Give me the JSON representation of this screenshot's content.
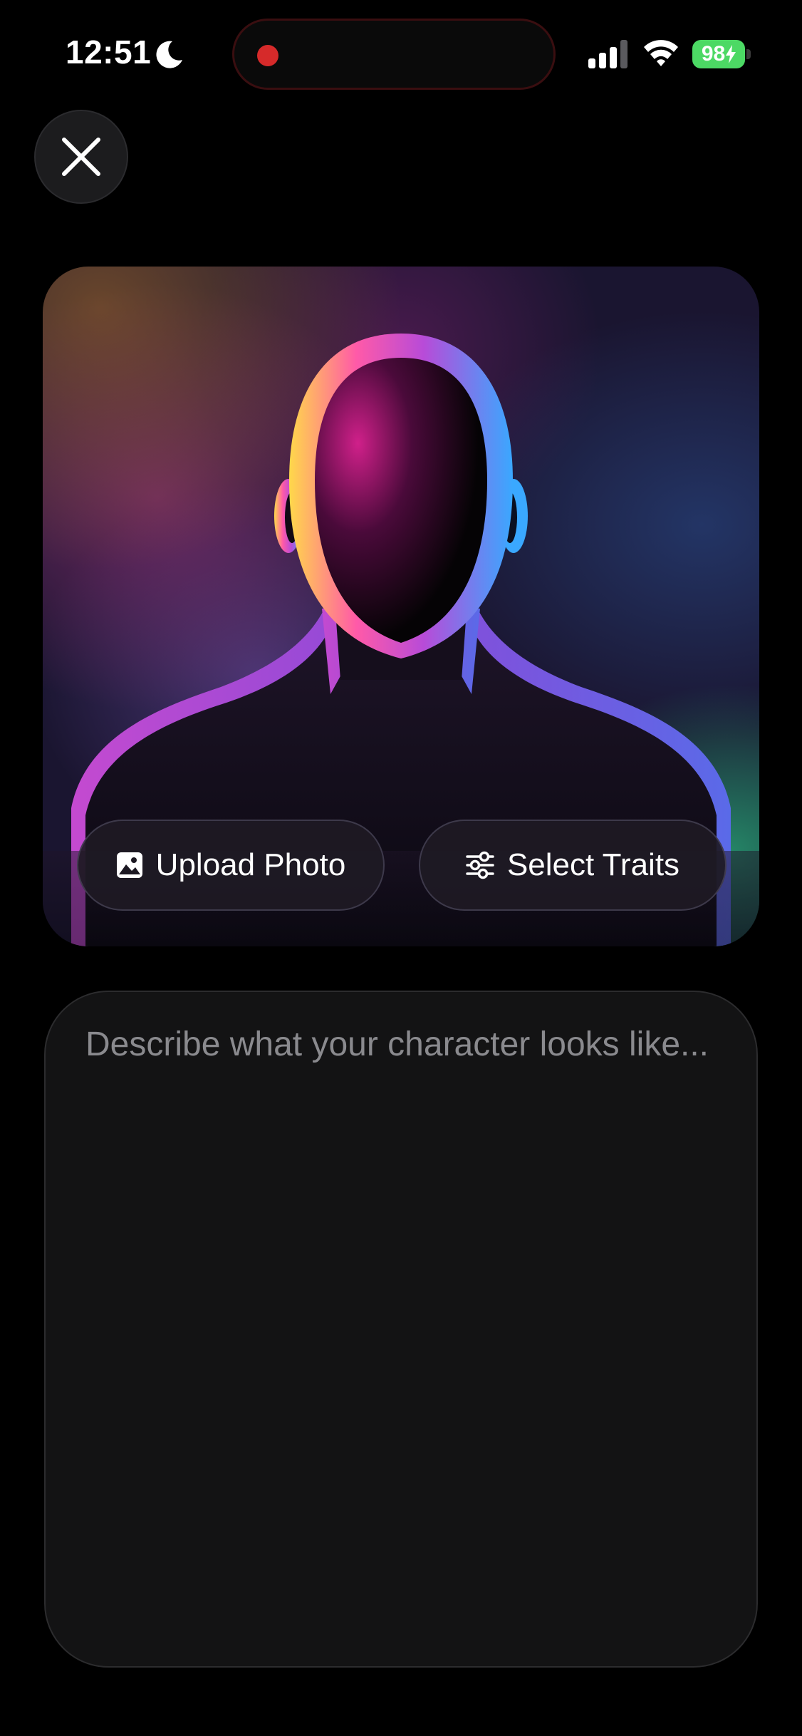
{
  "status_bar": {
    "time": "12:51",
    "battery_level": "98",
    "icons": [
      "moon-icon",
      "signal-icon",
      "wifi-icon",
      "battery-icon"
    ],
    "recording_color": "#d62a2a",
    "battery_color": "#4cd964"
  },
  "close_button": {
    "icon": "close-icon"
  },
  "hero": {
    "image": "head-silhouette-illustration",
    "buttons": {
      "upload_photo": {
        "label": "Upload Photo",
        "icon": "photo-icon"
      },
      "select_traits": {
        "label": "Select Traits",
        "icon": "sliders-icon"
      }
    }
  },
  "description": {
    "placeholder": "Describe what your character looks like...",
    "value": ""
  }
}
